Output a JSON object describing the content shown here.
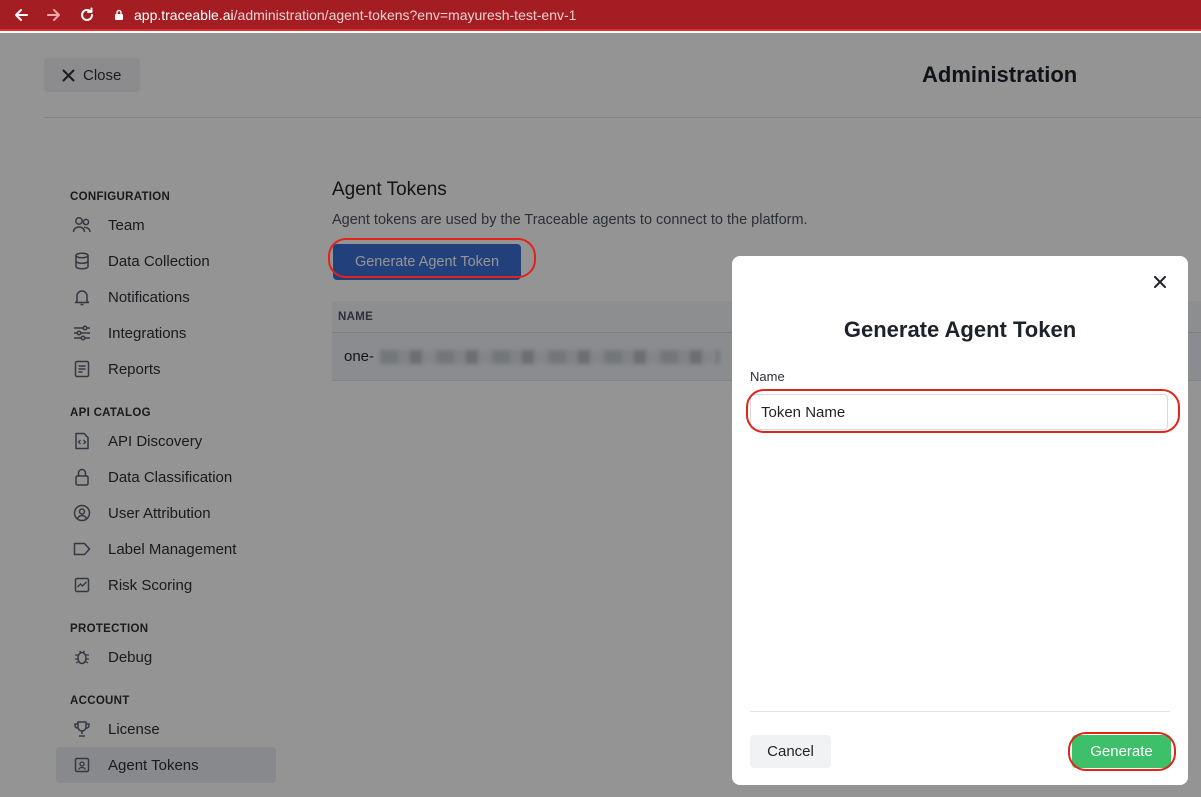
{
  "browser": {
    "url_host": "app.traceable.ai",
    "url_path": "/administration/agent-tokens?env=mayuresh-test-env-1",
    "icons": [
      "back-arrow-icon",
      "forward-arrow-icon",
      "reload-icon",
      "lock-icon"
    ]
  },
  "header": {
    "close_label": "Close",
    "title": "Administration"
  },
  "sidebar": {
    "sections": [
      {
        "title": "CONFIGURATION",
        "items": [
          {
            "label": "Team",
            "icon": "team-icon"
          },
          {
            "label": "Data Collection",
            "icon": "database-icon"
          },
          {
            "label": "Notifications",
            "icon": "bell-icon"
          },
          {
            "label": "Integrations",
            "icon": "sliders-icon"
          },
          {
            "label": "Reports",
            "icon": "report-icon"
          }
        ]
      },
      {
        "title": "API CATALOG",
        "items": [
          {
            "label": "API Discovery",
            "icon": "code-file-icon"
          },
          {
            "label": "Data Classification",
            "icon": "lock-icon"
          },
          {
            "label": "User Attribution",
            "icon": "user-circle-icon"
          },
          {
            "label": "Label Management",
            "icon": "tag-icon"
          },
          {
            "label": "Risk Scoring",
            "icon": "chart-icon"
          }
        ]
      },
      {
        "title": "PROTECTION",
        "items": [
          {
            "label": "Debug",
            "icon": "bug-icon"
          }
        ]
      },
      {
        "title": "ACCOUNT",
        "items": [
          {
            "label": "License",
            "icon": "trophy-icon"
          },
          {
            "label": "Agent Tokens",
            "icon": "token-icon",
            "active": true
          }
        ]
      }
    ]
  },
  "main": {
    "title": "Agent Tokens",
    "description": "Agent tokens are used by the Traceable agents to connect to the platform.",
    "generate_button": "Generate Agent Token",
    "table": {
      "columns": [
        "NAME"
      ],
      "rows": [
        {
          "name_prefix": "one-"
        }
      ]
    }
  },
  "modal": {
    "title": "Generate Agent Token",
    "field_label": "Name",
    "field_value": "Token Name",
    "cancel_label": "Cancel",
    "generate_label": "Generate"
  },
  "colors": {
    "browser_bar": "#a31d22",
    "primary_button": "#3b6fd6",
    "generate_button": "#3ebf6a",
    "highlight": "#e2231a"
  }
}
